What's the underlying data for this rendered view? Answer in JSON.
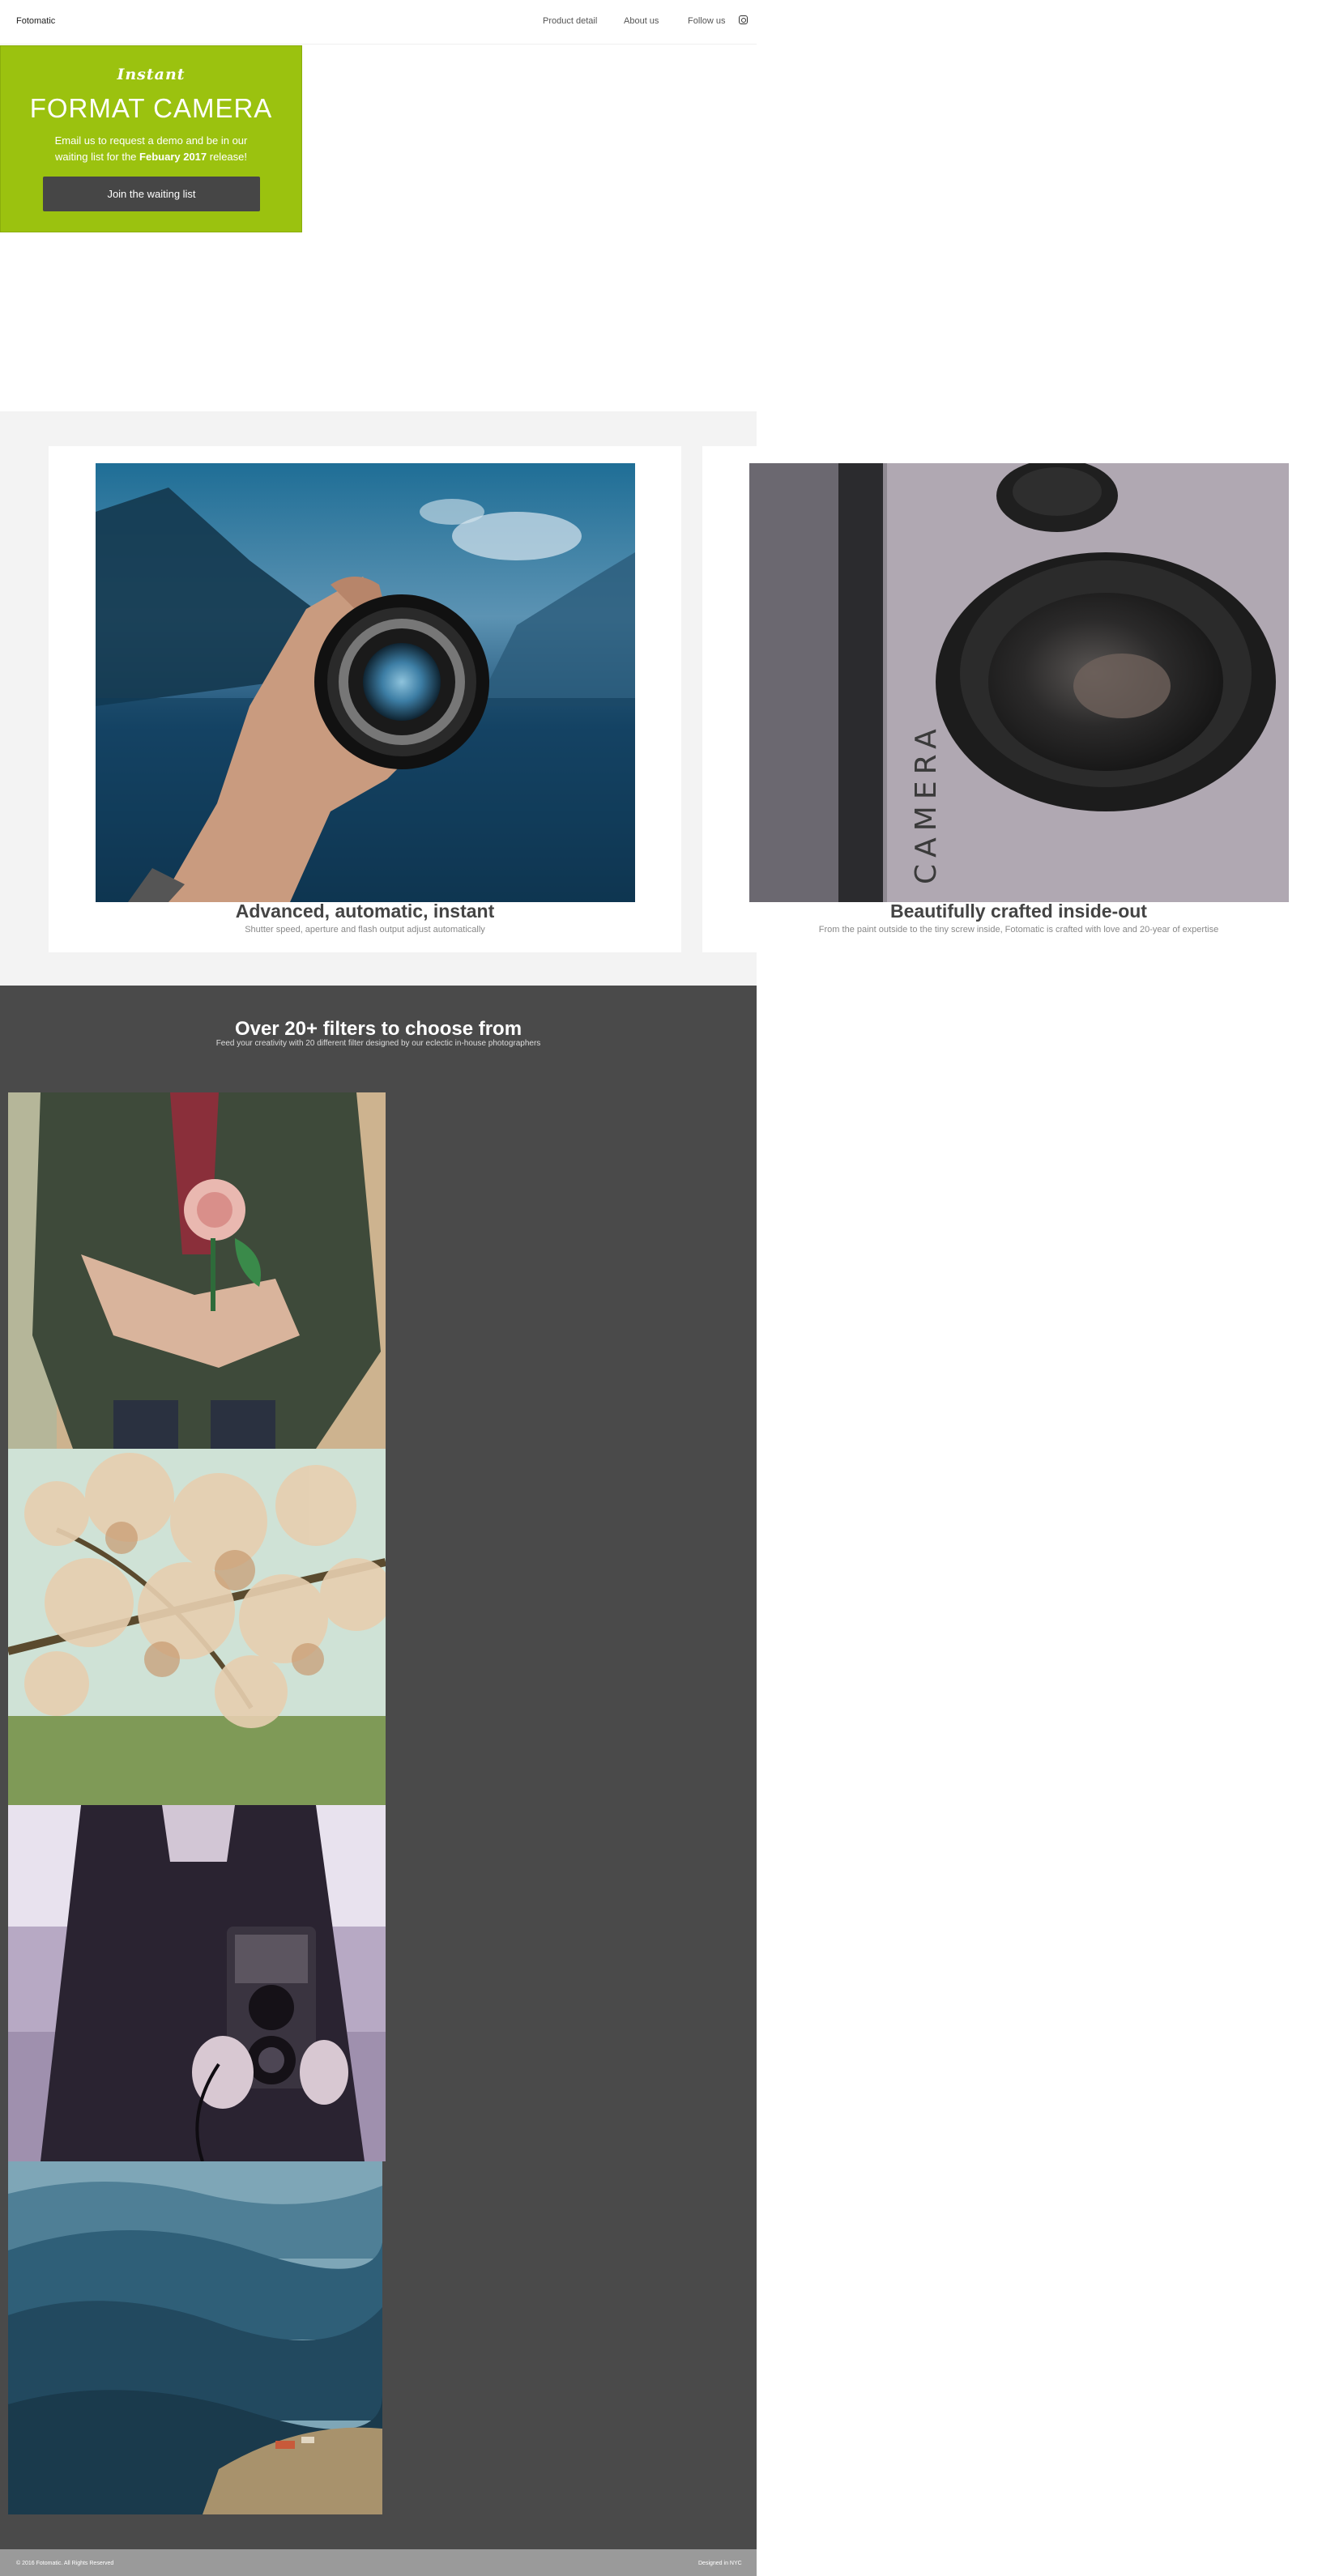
{
  "nav": {
    "brand": "Fotomatic",
    "links": [
      "Product detail",
      "About us",
      "Follow us"
    ],
    "social_icon": "instagram-icon"
  },
  "hero": {
    "script": "Instant",
    "title": "FORMAT CAMERA",
    "desc_line1": "Email us to request a demo and be in our",
    "desc_prefix": "waiting list for the ",
    "desc_bold": "Febuary 2017",
    "desc_suffix": " release!",
    "button": "Join the waiting list",
    "accent": "#9bc20f"
  },
  "features": [
    {
      "title": "Advanced, automatic, instant",
      "sub": "Shutter speed, aperture and flash output adjust automatically",
      "image": "hand holding camera lens over lake"
    },
    {
      "title": "Beautifully crafted inside-out",
      "sub": "From the paint outside to the tiny screw inside, Fotomatic is crafted with love and 20-year of expertise",
      "image": "close-up of camera lens body"
    }
  ],
  "filters": {
    "title": "Over 20+ filters to choose from",
    "sub": "Feed your creativity with 20 different filter designed by our eclectic in-house photographers",
    "images": [
      "person holding a rose",
      "blossoming tree branches",
      "man holding twin-lens camera",
      "blue mountain valley"
    ]
  },
  "footer": {
    "left": "© 2016 Fotomatic. All Rights Reserved",
    "right": "Designed in NYC"
  },
  "colors": {
    "hero": "#9bc20f",
    "dark": "#4a4a4a",
    "band": "#f3f3f3",
    "footer": "#9a9a9a"
  }
}
